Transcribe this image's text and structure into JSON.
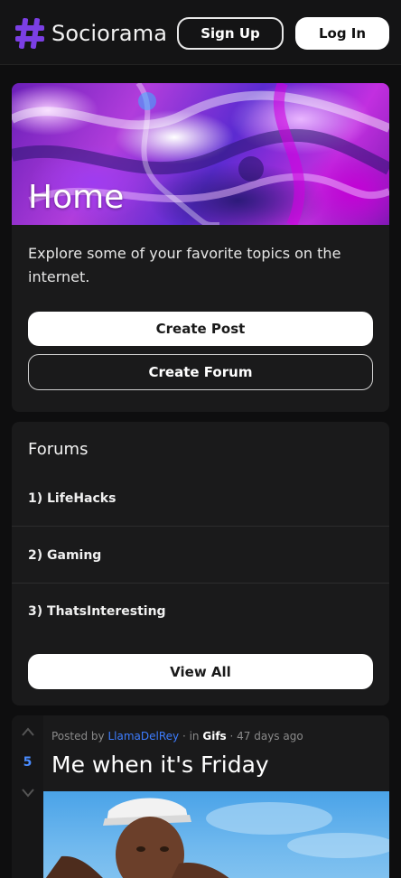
{
  "header": {
    "brand_name": "Sociorama",
    "brand_icon": "hash-icon",
    "signup_label": "Sign Up",
    "login_label": "Log In"
  },
  "home": {
    "title": "Home",
    "description": "Explore some of your favorite topics on the internet.",
    "create_post_label": "Create Post",
    "create_forum_label": "Create Forum"
  },
  "forums": {
    "title": "Forums",
    "items": [
      {
        "label": "1) LifeHacks"
      },
      {
        "label": "2) Gaming"
      },
      {
        "label": "3) ThatsInteresting"
      }
    ],
    "view_all_label": "View All"
  },
  "post": {
    "votes": "5",
    "posted_by_prefix": "Posted by",
    "author": "LlamaDelRey",
    "in_text": "· in",
    "forum": "Gifs",
    "age": "· 47 days ago",
    "title": "Me when it's Friday"
  },
  "colors": {
    "accent_purple": "#7b3fe4",
    "link_blue": "#3d7dff",
    "vote_blue": "#4a8cff",
    "card_bg": "#1a1a1b",
    "page_bg": "#0e0e0f"
  }
}
